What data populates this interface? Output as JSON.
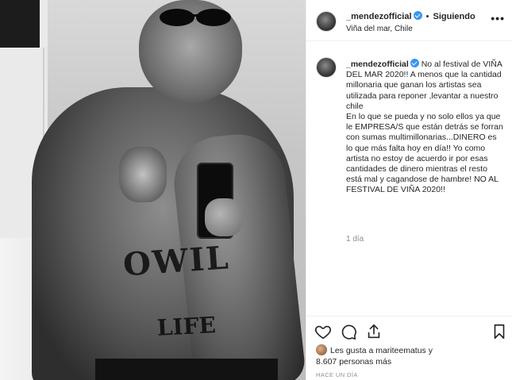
{
  "post": {
    "author": "_mendezofficial",
    "follow_status": "Siguiendo",
    "location": "Viña del mar, Chile",
    "caption": "No al festival de VIÑA DEL MAR 2020!! A menos que la cantidad millonaria que ganan los artistas sea utilizada para reponer ,levantar a nuestro chile\nEn lo que se pueda y no solo ellos ya que le EMPRESA/S que están detrás se forran con sumas multimillonarias...DINERO es lo que más falta hoy en día!! Yo como artista no estoy de acuerdo ir por esas cantidades de dinero mientras el resto está mal y cagandose de hambre! NO AL FESTIVAL DE VIÑA 2020!!",
    "caption_time": "1 día",
    "likes_line1": "Les gusta a mariteematus y",
    "likes_line2": "8.607 personas más",
    "posted_ago": "HACE UN DÍA",
    "more_label": "•••",
    "separator": "•"
  },
  "photo": {
    "tattoo_text_top": "OWIL",
    "tattoo_text_bottom": "LIFE"
  },
  "icons": {
    "verified": "verified-badge-icon",
    "heart": "heart-icon",
    "comment": "comment-icon",
    "share": "share-icon",
    "save": "bookmark-icon"
  },
  "colors": {
    "verified_blue": "#3897f0",
    "text": "#262626",
    "muted": "#8e8e8e",
    "border": "#efefef"
  }
}
